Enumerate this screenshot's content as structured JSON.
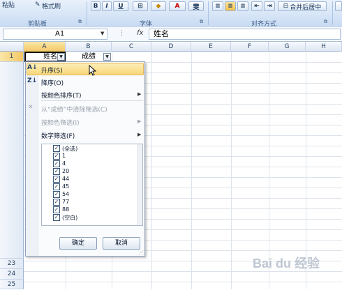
{
  "ribbon": {
    "paste_label": "粘贴",
    "format_painter": "格式刷",
    "bold": "B",
    "italic": "I",
    "underline": "U",
    "font_color_letter": "A",
    "phonetic": "雯",
    "merge_center": "合并后居中",
    "clipboard_group": "剪贴板",
    "font_group": "字体",
    "alignment_group": "对齐方式"
  },
  "formula_bar": {
    "name_box": "A1",
    "fx": "fx",
    "content": "姓名"
  },
  "columns": [
    "A",
    "B",
    "C",
    "D",
    "E",
    "F",
    "G",
    "H"
  ],
  "header_cells": {
    "a1": "姓名",
    "b1": "成绩"
  },
  "rows_visible": [
    "1",
    "23",
    "24",
    "25"
  ],
  "filter_menu": {
    "sort_asc": "升序(S)",
    "sort_desc": "降序(O)",
    "sort_by_color": "按颜色排序(T)",
    "clear_filter": "从“成绩”中清除筛选(C)",
    "filter_by_color": "按颜色筛选(I)",
    "number_filters": "数字筛选(F)",
    "values": [
      {
        "label": "(全选)",
        "checked": true
      },
      {
        "label": "1",
        "checked": true
      },
      {
        "label": "4",
        "checked": true
      },
      {
        "label": "20",
        "checked": true
      },
      {
        "label": "44",
        "checked": true
      },
      {
        "label": "45",
        "checked": true
      },
      {
        "label": "54",
        "checked": true
      },
      {
        "label": "77",
        "checked": true
      },
      {
        "label": "88",
        "checked": true
      },
      {
        "label": "(空白)",
        "checked": true
      }
    ],
    "ok_label": "确定",
    "cancel_label": "取消"
  },
  "watermark": "Bai du 经验",
  "colors": {
    "ribbon_bg": "#c9dcf3",
    "highlight": "#fbe08a",
    "check": "#1a2f4a"
  }
}
